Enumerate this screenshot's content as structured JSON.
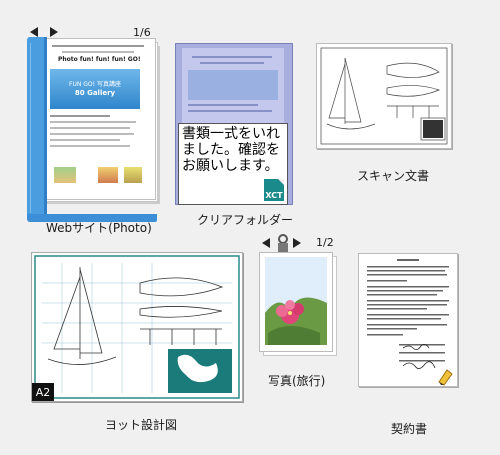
{
  "items": [
    {
      "label": "Webサイト(Photo)",
      "page_indicator": "1/6",
      "page": {
        "header_title": "Photo fun! fun! fun! GO!",
        "banner_lines": [
          "FUN GO! 写真講座",
          "80 Gallery"
        ]
      }
    },
    {
      "label": "クリアフォルダー",
      "note_text": "書類一式をいれました。確認をお願いします。",
      "badge": "XCT"
    },
    {
      "label": "スキャン文書"
    },
    {
      "label": "ヨット設計図",
      "badge": "A2"
    },
    {
      "label": "写真(旅行)",
      "page_indicator": "1/2"
    },
    {
      "label": "契約書"
    }
  ],
  "icons": [
    "prev-page-icon",
    "next-page-icon",
    "clip-icon",
    "xct-file-icon",
    "signature-pen-icon"
  ],
  "colors": {
    "background": "#f0f0f0",
    "binder_spine": "#4a9ee0",
    "folder": "#a8aedd",
    "xct": "#1a8a8a"
  }
}
